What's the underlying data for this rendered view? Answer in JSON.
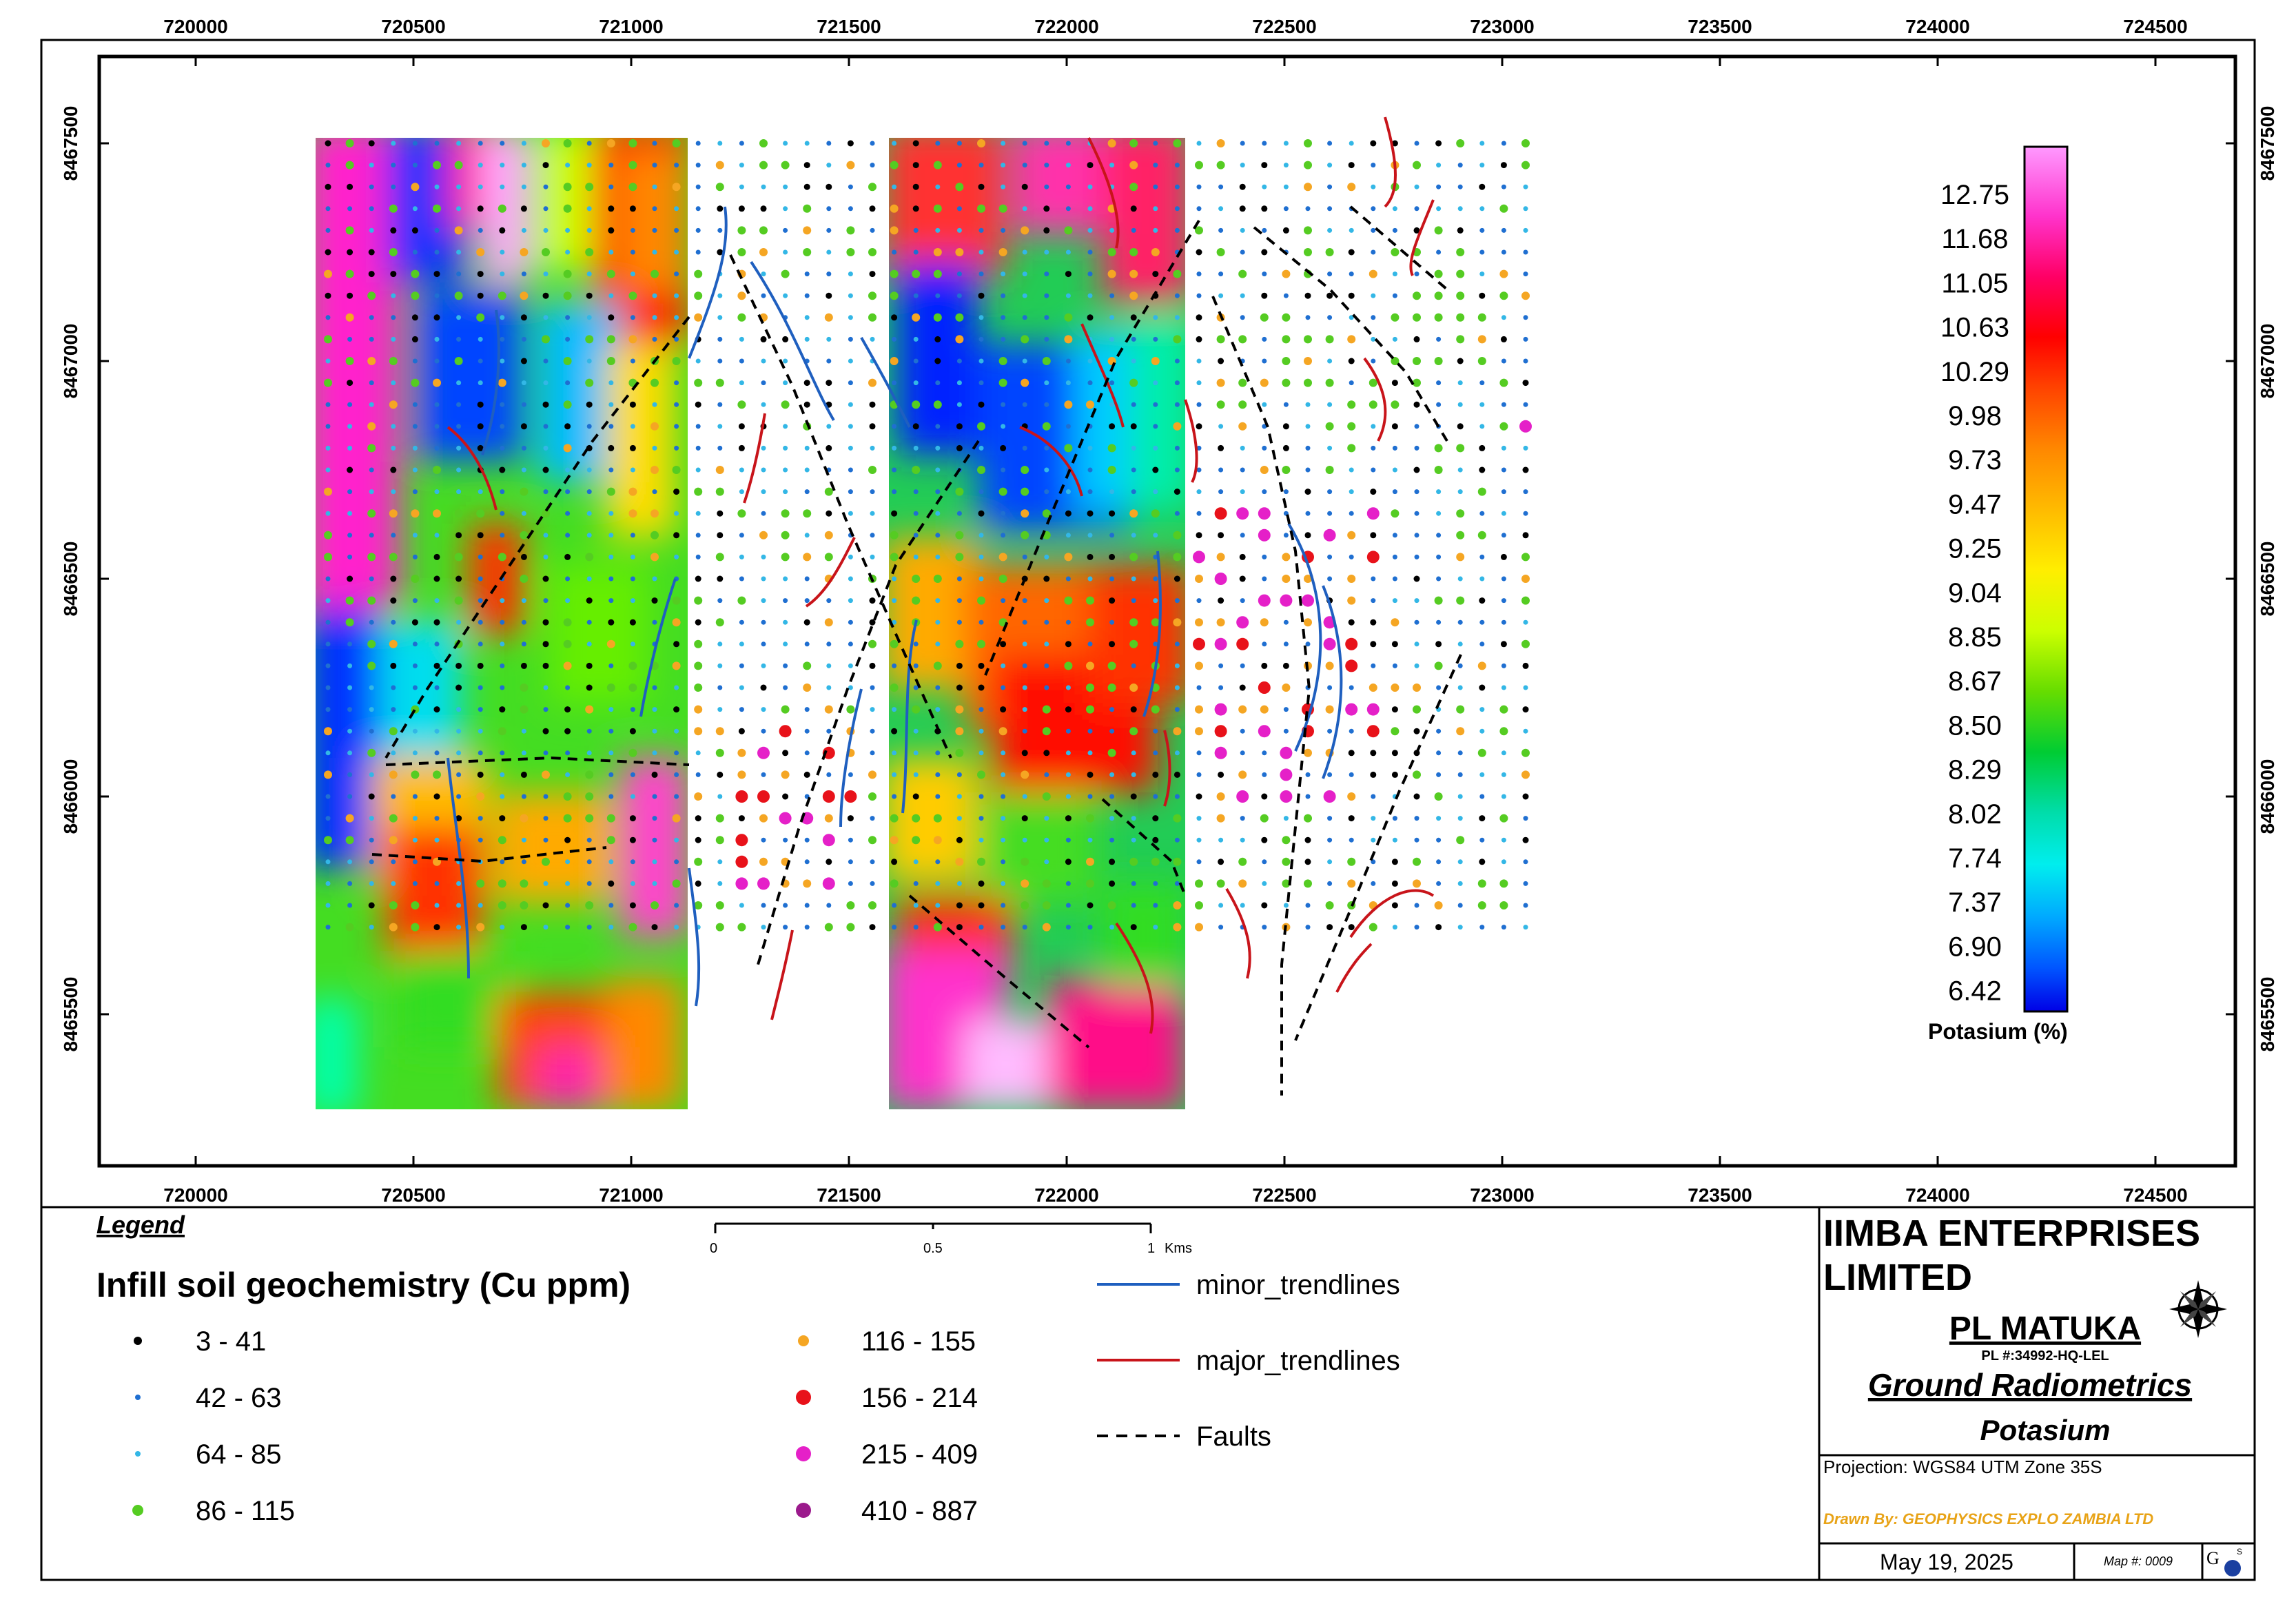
{
  "map": {
    "x_ticks": [
      "720000",
      "720500",
      "721000",
      "721500",
      "722000",
      "722500",
      "723000",
      "723500",
      "724000",
      "724500"
    ],
    "y_ticks": [
      "8467500",
      "8467000",
      "8466500",
      "8466000",
      "8465500"
    ]
  },
  "colorbar": {
    "title": "Potasium (%)",
    "labels": [
      "12.75",
      "11.68",
      "11.05",
      "10.63",
      "10.29",
      "9.98",
      "9.73",
      "9.47",
      "9.25",
      "9.04",
      "8.85",
      "8.67",
      "8.50",
      "8.29",
      "8.02",
      "7.74",
      "7.37",
      "6.90",
      "6.42"
    ],
    "colors": [
      "#ff99ff",
      "#ff33cc",
      "#ff0066",
      "#ff0000",
      "#ff3300",
      "#ff6600",
      "#ff9900",
      "#ffbb00",
      "#ffdd00",
      "#ffff00",
      "#ccff00",
      "#99ee00",
      "#55dd00",
      "#00cc44",
      "#00ddaa",
      "#00eeee",
      "#00bbff",
      "#0088ff",
      "#0044ff",
      "#0000ee"
    ]
  },
  "legend": {
    "heading": "Legend",
    "title": "Infill soil geochemistry (Cu ppm)",
    "classes": [
      {
        "label": "3 - 41",
        "color": "#000000",
        "size": "small"
      },
      {
        "label": "42 - 63",
        "color": "#1f6fd1",
        "size": "tiny"
      },
      {
        "label": "64 - 85",
        "color": "#33b7e6",
        "size": "tiny"
      },
      {
        "label": "86 - 115",
        "color": "#55cc22",
        "size": "medium"
      },
      {
        "label": "116 - 155",
        "color": "#f5a623",
        "size": "medium"
      },
      {
        "label": "156 - 214",
        "color": "#e8121a",
        "size": "large"
      },
      {
        "label": "215 - 409",
        "color": "#e520c8",
        "size": "large"
      },
      {
        "label": "410 - 887",
        "color": "#9b1a8c",
        "size": "large"
      }
    ],
    "lines": [
      {
        "label": "minor_trendlines",
        "color": "#1f5fbf",
        "style": "solid"
      },
      {
        "label": "major_trendlines",
        "color": "#c8141a",
        "style": "solid"
      },
      {
        "label": "Faults",
        "color": "#000000",
        "style": "dashed"
      }
    ],
    "scale": {
      "labels": [
        "0",
        "0.5",
        "1"
      ],
      "unit": "Kms"
    }
  },
  "title_block": {
    "company": "IIMBA ENTERPRISES LIMITED",
    "company_line1": "IIMBA ENTERPRISES",
    "company_line2": "LIMITED",
    "project": "PL MATUKA",
    "licence": "PL #:34992-HQ-LEL",
    "survey": "Ground Radiometrics",
    "parameter": "Potasium",
    "projection": "Projection: WGS84 UTM Zone 35S",
    "drawn_by": "Drawn By: GEOPHYSICS EXPLO ZAMBIA LTD",
    "date": "May 19, 2025",
    "map_number": "Map #: 0009",
    "accent_color": "#e8a317",
    "north_arrow_icon": "compass-rose-icon",
    "logo_icon": "company-logo-icon"
  }
}
